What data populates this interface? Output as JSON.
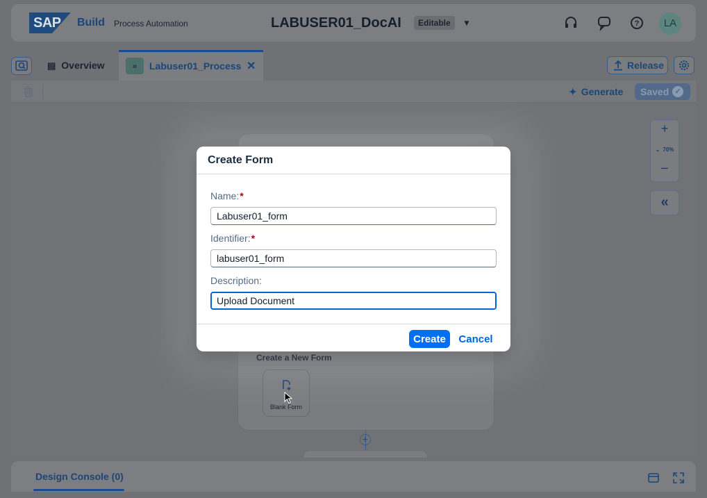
{
  "shell": {
    "logo": "SAP",
    "build": "Build",
    "product": "Process Automation",
    "project_title": "LABUSER01_DocAI",
    "status_badge": "Editable",
    "avatar_initials": "LA"
  },
  "tabs": {
    "overview": "Overview",
    "process": "Labuser01_Process"
  },
  "header_actions": {
    "release": "Release"
  },
  "toolbar": {
    "generate": "Generate",
    "saved": "Saved"
  },
  "canvas": {
    "create_new_form_label": "Create a New Form",
    "blank_form_label": "Blank Form",
    "zoom_level": "70%"
  },
  "console": {
    "tab_label": "Design Console (0)"
  },
  "dialog": {
    "title": "Create Form",
    "fields": {
      "name_label": "Name:",
      "name_value": "Labuser01_form",
      "identifier_label": "Identifier:",
      "identifier_value": "labuser01_form",
      "description_label": "Description:",
      "description_value": "Upload Document"
    },
    "create_button": "Create",
    "cancel_button": "Cancel"
  },
  "colors": {
    "accent": "#0070f2",
    "link": "#0064d9",
    "required": "#aa0808"
  }
}
